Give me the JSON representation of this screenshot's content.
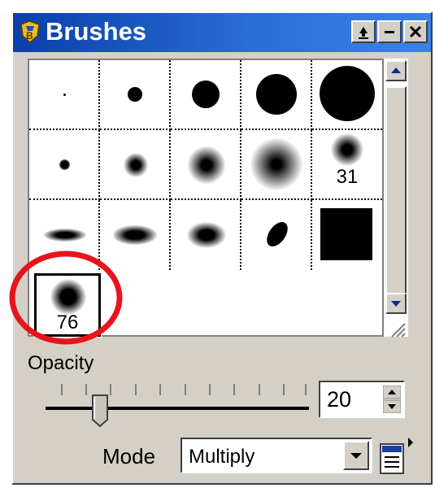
{
  "window": {
    "title": "Brushes"
  },
  "titlebar_buttons": [
    {
      "name": "pin-icon"
    },
    {
      "name": "minimize-icon"
    },
    {
      "name": "close-icon"
    }
  ],
  "brushes": [
    {
      "label": ""
    },
    {
      "label": ""
    },
    {
      "label": ""
    },
    {
      "label": ""
    },
    {
      "label": ""
    },
    {
      "label": ""
    },
    {
      "label": ""
    },
    {
      "label": ""
    },
    {
      "label": ""
    },
    {
      "label": "31"
    },
    {
      "label": ""
    },
    {
      "label": ""
    },
    {
      "label": ""
    },
    {
      "label": ""
    },
    {
      "label": ""
    },
    {
      "label": "76"
    }
  ],
  "opacity": {
    "label": "Opacity",
    "value": "20"
  },
  "mode": {
    "label": "Mode",
    "value": "Multiply"
  },
  "colors": {
    "title_gradient_start": "#0a3fa8",
    "title_gradient_end": "#3a82e8",
    "face": "#d4d0c8",
    "annotation": "#e8141c"
  }
}
